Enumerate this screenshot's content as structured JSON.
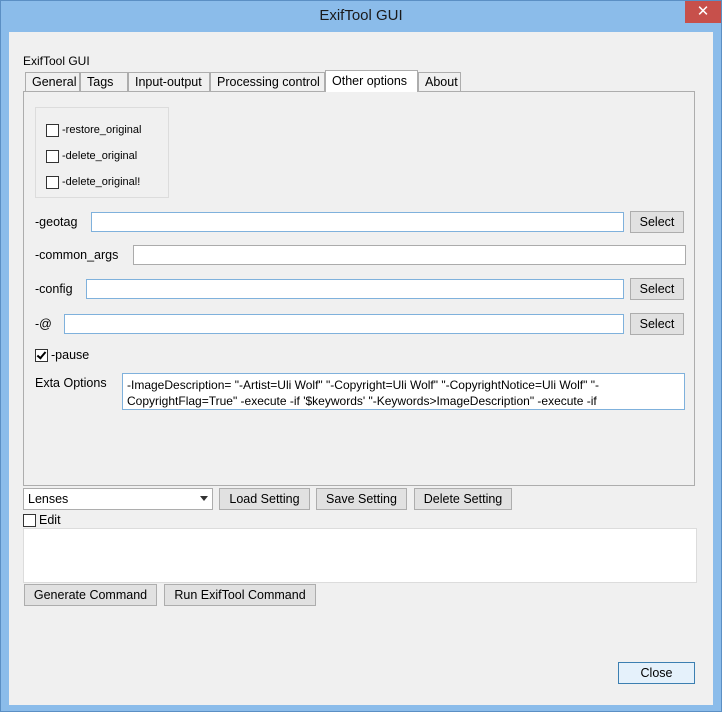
{
  "window": {
    "title": "ExifTool GUI",
    "close_glyph": "✕"
  },
  "app_label": "ExifTool GUI",
  "tabs": [
    {
      "label": "General"
    },
    {
      "label": "Tags"
    },
    {
      "label": "Input-output"
    },
    {
      "label": "Processing control"
    },
    {
      "label": "Other options",
      "active": true
    },
    {
      "label": "About"
    }
  ],
  "options_group": {
    "items": [
      {
        "label": "-restore_original",
        "checked": false
      },
      {
        "label": "-delete_original",
        "checked": false
      },
      {
        "label": "-delete_original!",
        "checked": false
      }
    ]
  },
  "fields": {
    "geotag": {
      "label": "-geotag",
      "value": "",
      "button": "Select"
    },
    "common_args": {
      "label": "-common_args",
      "value": ""
    },
    "config": {
      "label": "-config",
      "value": "",
      "button": "Select"
    },
    "at": {
      "label": "-@",
      "value": "",
      "button": "Select"
    }
  },
  "pause": {
    "label": "-pause",
    "checked": true
  },
  "extra_options": {
    "label": "Exta Options",
    "value": "-ImageDescription= \"-Artist=Uli Wolf\" \"-Copyright=Uli Wolf\" \"-CopyrightNotice=Uli Wolf\" \"-CopyrightFlag=True\" -execute -if '$keywords' \"-Keywords>ImageDescription\" -execute -if"
  },
  "settings": {
    "selected": "Lenses",
    "load_label": "Load Setting",
    "save_label": "Save Setting",
    "delete_label": "Delete Setting"
  },
  "edit": {
    "label": "Edit",
    "checked": false
  },
  "command_output": "",
  "actions": {
    "generate_label": "Generate Command",
    "run_label": "Run ExifTool Command",
    "close_label": "Close"
  }
}
